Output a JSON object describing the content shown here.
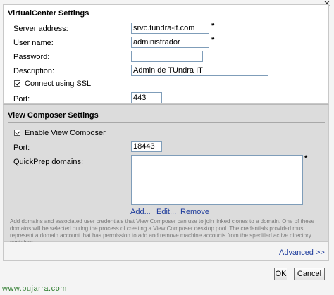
{
  "dialog": {
    "close_icon": "close-icon",
    "close_glyph": "×"
  },
  "virtualcenter": {
    "title": "VirtualCenter Settings",
    "server_label": "Server address:",
    "server_value": "srvc.tundra-it.com",
    "user_label": "User name:",
    "user_value": "administrador",
    "password_label": "Password:",
    "password_value": "",
    "description_label": "Description:",
    "description_value": "Admin de TUndra IT",
    "ssl_label": "Connect using SSL",
    "ssl_checked": true,
    "port_label": "Port:",
    "port_value": "443",
    "required_mark": "*"
  },
  "view_composer": {
    "title": "View Composer Settings",
    "enable_label": "Enable View Composer",
    "enable_checked": true,
    "port_label": "Port:",
    "port_value": "18443",
    "quickprep_label": "QuickPrep domains:",
    "required_mark": "*",
    "add_label": "Add...",
    "edit_label": "Edit...",
    "remove_label": "Remove",
    "help_text": "Add domains and associated user credentials that View Composer can use to join linked clones to a domain. One of these domains will be selected during the process of creating a View Composer desktop pool. The credentials provided must represent a domain account that has permission to add and remove machine accounts from the specified active directory container."
  },
  "footer": {
    "advanced_label": "Advanced >>",
    "ok_label": "OK",
    "cancel_label": "Cancel"
  },
  "watermark": "www.bujarra.com",
  "colors": {
    "link": "#1f3d9c",
    "section_bg": "#dcdcdc",
    "input_border": "#7f9db9"
  }
}
